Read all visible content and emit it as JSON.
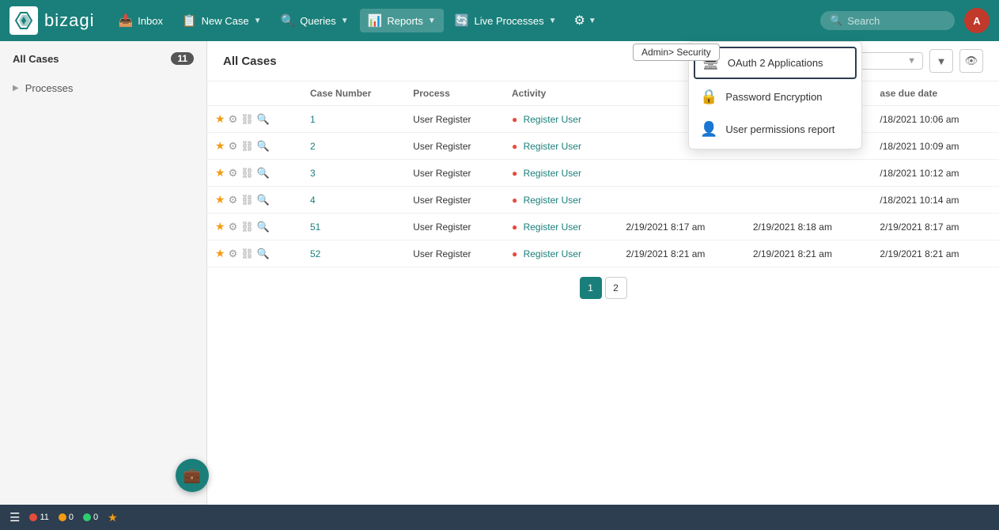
{
  "app": {
    "logo_text": "bizagi",
    "avatar_initials": "A"
  },
  "navbar": {
    "inbox_label": "Inbox",
    "new_case_label": "New Case",
    "queries_label": "Queries",
    "reports_label": "Reports",
    "live_processes_label": "Live Processes",
    "search_placeholder": "Search"
  },
  "sidebar": {
    "all_cases_label": "All Cases",
    "all_cases_count": "11",
    "processes_label": "Processes"
  },
  "content": {
    "title": "All Cases",
    "columns": {
      "case_number": "Case Number",
      "process": "Process",
      "activity": "Activity",
      "case_due_date": "ase due date"
    }
  },
  "table": {
    "rows": [
      {
        "num": "1",
        "process": "User Register",
        "activity": "Register User",
        "d1": "",
        "d2": "",
        "d3": "/18/2021 10:06 am"
      },
      {
        "num": "2",
        "process": "User Register",
        "activity": "Register User",
        "d1": "",
        "d2": "",
        "d3": "/18/2021 10:09 am"
      },
      {
        "num": "3",
        "process": "User Register",
        "activity": "Register User",
        "d1": "",
        "d2": "",
        "d3": "/18/2021 10:12 am"
      },
      {
        "num": "4",
        "process": "User Register",
        "activity": "Register User",
        "d1": "",
        "d2": "",
        "d3": "/18/2021 10:14 am"
      },
      {
        "num": "51",
        "process": "User Register",
        "activity": "Register User",
        "d1": "2/19/2021 8:17 am",
        "d2": "2/19/2021 8:18 am",
        "d3": "2/19/2021 8:17 am"
      },
      {
        "num": "52",
        "process": "User Register",
        "activity": "Register User",
        "d1": "2/19/2021 8:21 am",
        "d2": "2/19/2021 8:21 am",
        "d3": "2/19/2021 8:21 am"
      }
    ]
  },
  "pagination": {
    "current": "1",
    "next": "2"
  },
  "dropdown": {
    "breadcrumb": "Admin> Security",
    "items": [
      {
        "id": "oauth2",
        "icon": "🖥",
        "label": "OAuth 2 Applications",
        "highlighted": true
      },
      {
        "id": "password",
        "icon": "🔒",
        "label": "Password Encryption",
        "highlighted": false
      },
      {
        "id": "permissions",
        "icon": "👤",
        "label": "User permissions report",
        "highlighted": false
      }
    ]
  },
  "bottom_bar": {
    "red_count": "11",
    "yellow_count": "0",
    "green_count": "0"
  },
  "colors": {
    "brand": "#1a7f7a",
    "navbar_bg": "#1a7f7a",
    "bottom_bar_bg": "#2c3e50"
  }
}
